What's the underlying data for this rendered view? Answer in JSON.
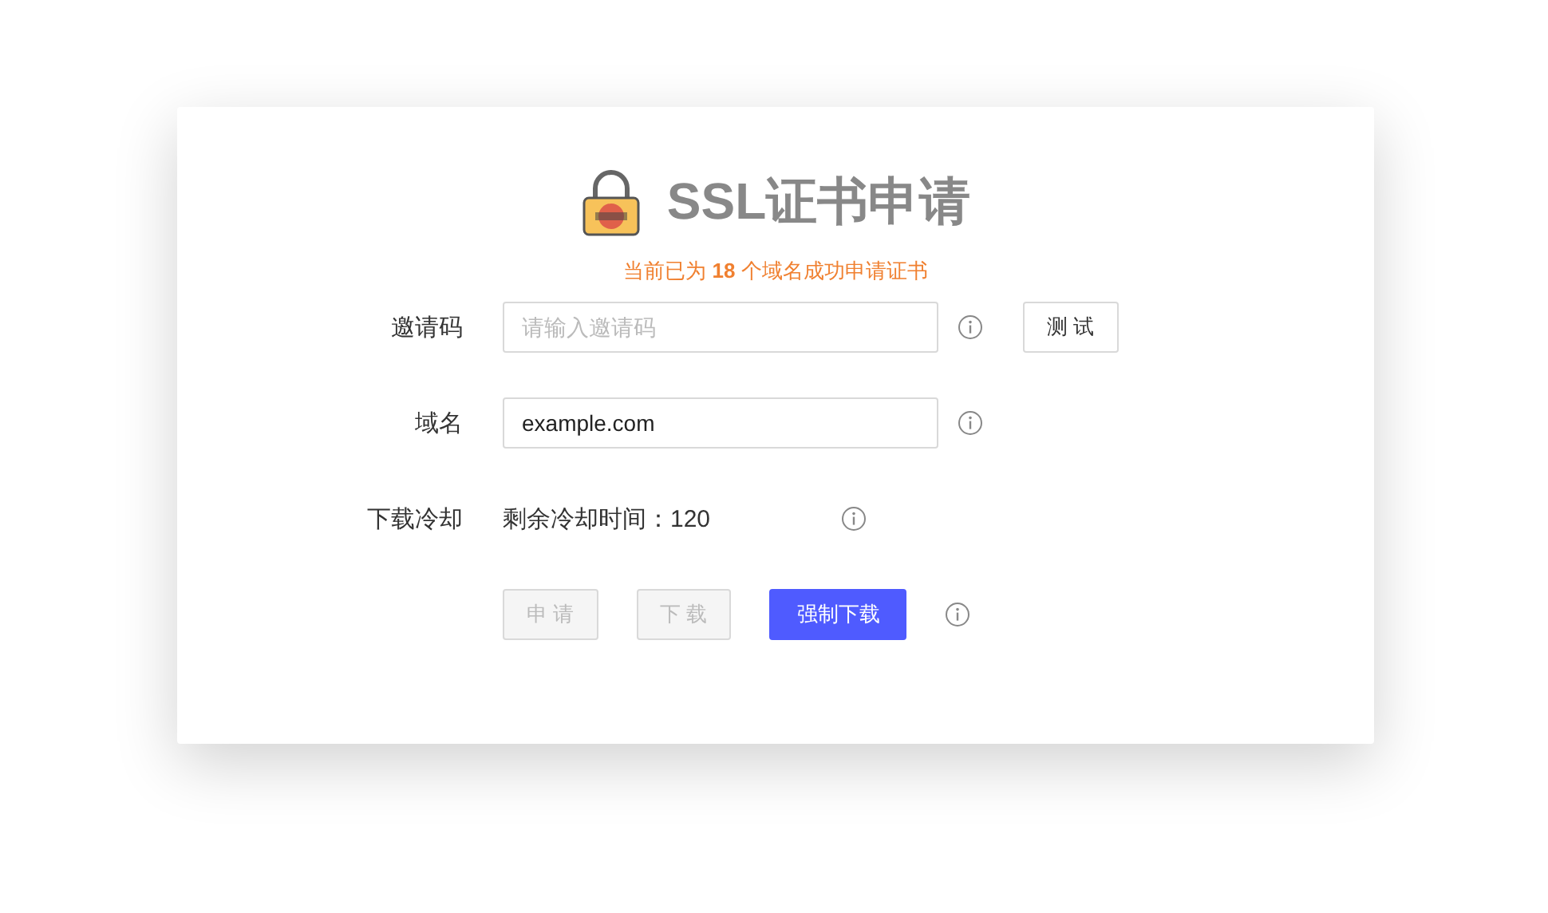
{
  "header": {
    "title": "SSL证书申请",
    "subtitle": "当前已为 **18** 个域名成功申请证书"
  },
  "fields": [
    {
      "kind": "input",
      "label": "邀请码",
      "placeholder": "请输入邀请码",
      "button": "测 试"
    },
    {
      "kind": "input",
      "label": "域名",
      "value": "example.com"
    },
    {
      "kind": "text",
      "label": "下载冷却",
      "value": "剩余冷却时间：120"
    }
  ],
  "actions": [
    {
      "label": "申 请",
      "kind": "default",
      "disabled": true
    },
    {
      "label": "下 载",
      "kind": "default",
      "disabled": true
    },
    {
      "label": "强制下载",
      "kind": "primary",
      "disabled": false
    }
  ]
}
